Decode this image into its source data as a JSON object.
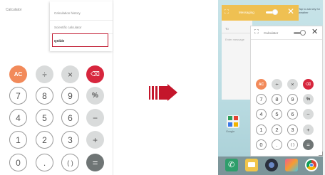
{
  "left_screen": {
    "header_title": "Calculator",
    "menu_items": [
      "Calculation history",
      "Scientific calculator",
      "QSlide"
    ],
    "keys": [
      [
        "AC",
        "÷",
        "×",
        "⌫"
      ],
      [
        "7",
        "8",
        "9",
        "%"
      ],
      [
        "4",
        "5",
        "6",
        "−"
      ],
      [
        "1",
        "2",
        "3",
        "+"
      ],
      [
        "0",
        ".",
        "( )",
        "="
      ]
    ]
  },
  "right_screen": {
    "messaging_title": "Messaging",
    "widget_hint": "Tap to add city for weather",
    "to_label": "To",
    "message_placeholder": "Enter message",
    "calc_window_title": "Calculator",
    "home_folder_label": "Google",
    "keys": [
      [
        "AC",
        "÷",
        "×",
        "⌫"
      ],
      [
        "7",
        "8",
        "9",
        "%"
      ],
      [
        "4",
        "5",
        "6",
        "−"
      ],
      [
        "1",
        "2",
        "3",
        "+"
      ],
      [
        "0",
        ".",
        "( )",
        "="
      ]
    ]
  },
  "colors": {
    "accent_red": "#c4162b",
    "ac_orange": "#f28a5a",
    "backspace_red": "#d7263d",
    "qslide_bar_yellow": "#f2bd45",
    "equals_gray": "#6f7575"
  }
}
